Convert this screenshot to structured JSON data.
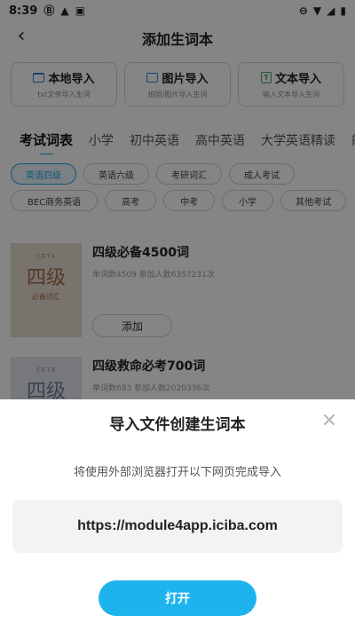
{
  "status_bar": {
    "time": "8:39",
    "left_icons": [
      "notification-b-icon",
      "warning-icon",
      "photo-icon"
    ],
    "battery_percent": 100
  },
  "header": {
    "title": "添加生词本",
    "back_icon": "chevron-left-icon"
  },
  "import_options": [
    {
      "icon": "folder-icon",
      "title": "本地导入",
      "subtitle": "txt文件导入生词"
    },
    {
      "icon": "image-icon",
      "title": "图片导入",
      "subtitle": "拍照/图片导入生词"
    },
    {
      "icon": "text-icon",
      "title": "文本导入",
      "subtitle": "输入文本导入生词"
    }
  ],
  "tabs": [
    {
      "label": "考试词表",
      "active": true
    },
    {
      "label": "小学",
      "active": false
    },
    {
      "label": "初中英语",
      "active": false
    },
    {
      "label": "高中英语",
      "active": false
    },
    {
      "label": "大学英语精读",
      "active": false
    },
    {
      "label": "能",
      "active": false
    }
  ],
  "chips": [
    {
      "label": "英语四级",
      "active": true
    },
    {
      "label": "英语六级",
      "active": false
    },
    {
      "label": "考研词汇",
      "active": false
    },
    {
      "label": "成人考试",
      "active": false
    },
    {
      "label": "BEC商务英语",
      "active": false
    },
    {
      "label": "高考",
      "active": false
    },
    {
      "label": "中考",
      "active": false
    },
    {
      "label": "小学",
      "active": false
    },
    {
      "label": "其他考试",
      "active": false
    }
  ],
  "books": [
    {
      "cover_tag": "CET4",
      "cover_title": "四级",
      "cover_subtitle": "必备词汇",
      "title": "四级必备4500词",
      "meta": "单词数4509  参加人数6357231次",
      "button": "添加"
    },
    {
      "cover_tag": "CET4",
      "cover_title": "四级",
      "title": "四级救命必考700词",
      "meta": "单词数683  参加人数2020336次"
    }
  ],
  "dialog": {
    "title": "导入文件创建生词本",
    "description": "将使用外部浏览器打开以下网页完成导入",
    "url": "https://module4app.iciba.com",
    "open_button": "打开",
    "close_icon": "close-icon"
  },
  "colors": {
    "accent": "#1DB4EE",
    "overlay": "rgba(0,0,0,0.48)",
    "sheet_background": "#FFFFFF"
  }
}
